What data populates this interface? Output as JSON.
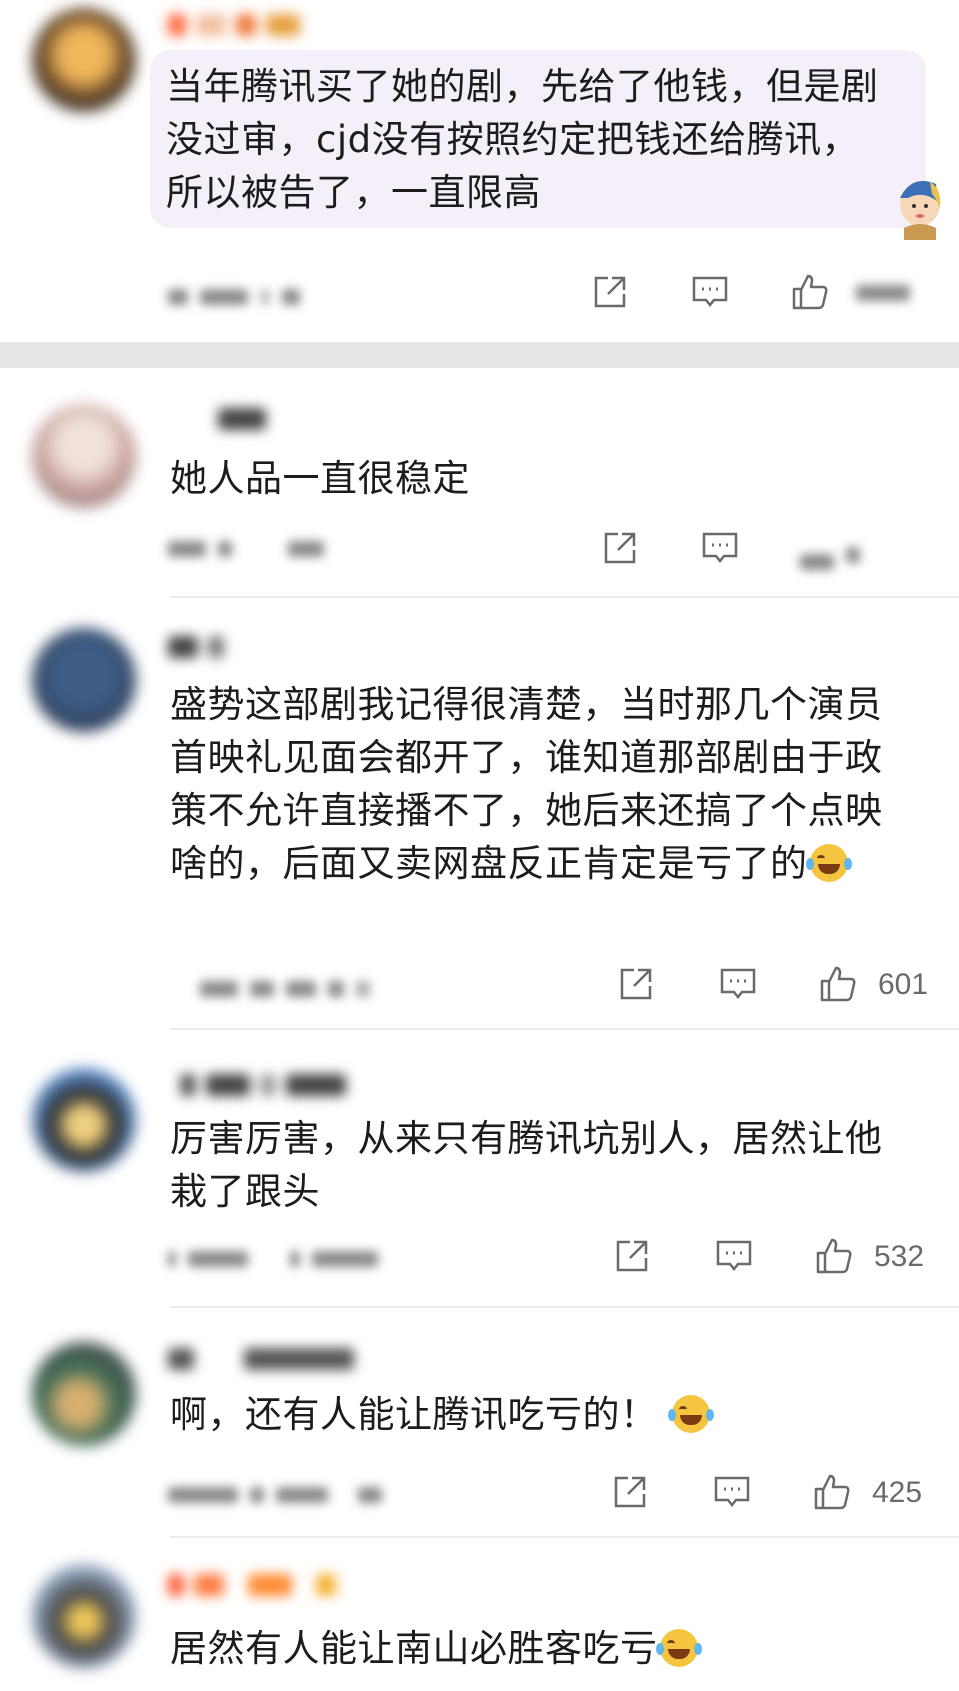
{
  "comments": [
    {
      "text": "当年腾讯买了她的剧，先给了他钱，但是剧没过审，cjd没有按照约定把钱还给腾讯，所以被告了，一直限高",
      "likes": ""
    },
    {
      "text": "她人品一直很稳定",
      "likes": ""
    },
    {
      "text": "盛势这部剧我记得很清楚，当时那几个演员首映礼见面会都开了，谁知道那部剧由于政策不允许直接播不了，她后来还搞了个点映啥的，后面又卖网盘反正肯定是亏了的",
      "likes": "601"
    },
    {
      "text": "厉害厉害，从来只有腾讯坑别人，居然让他栽了跟头",
      "likes": "532"
    },
    {
      "text": "啊，还有人能让腾讯吃亏的！",
      "likes": "425"
    },
    {
      "text": "居然有人能让南山必胜客吃亏",
      "likes": ""
    }
  ],
  "icons": {
    "share": "share-icon",
    "reply": "reply-icon",
    "like": "like-icon",
    "emoji": "laughing-crying-emoji"
  },
  "colors": {
    "highlight_bubble": "#f4eff8",
    "section_gap": "#e6e6e6",
    "icon_gray": "#6a6a6a"
  }
}
